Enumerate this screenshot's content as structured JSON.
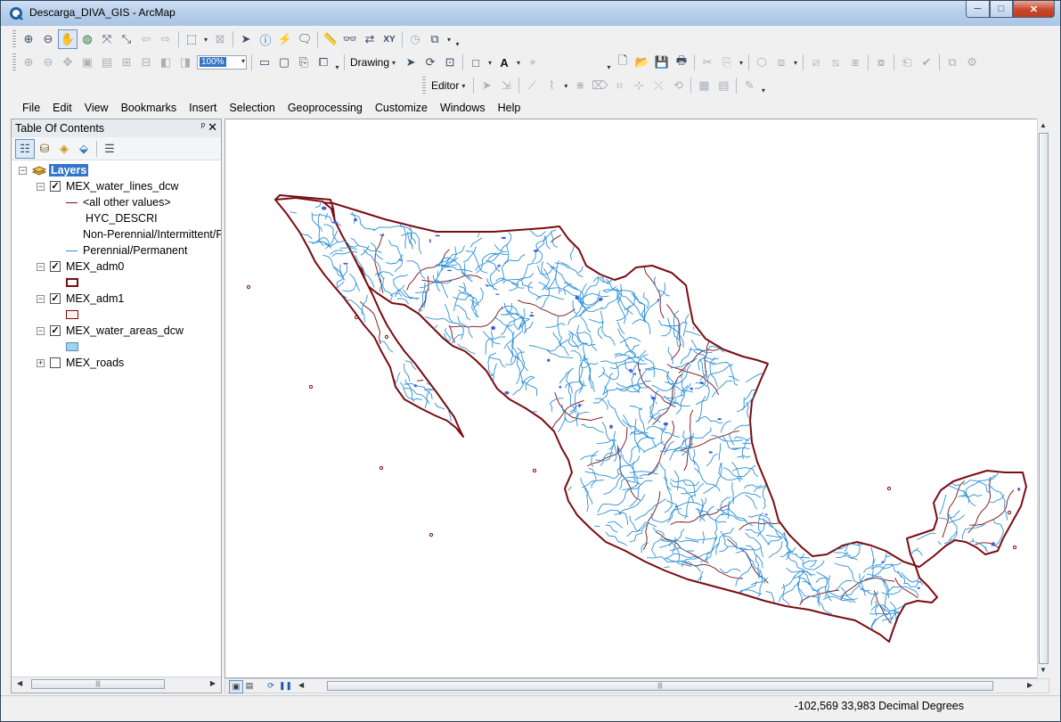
{
  "window": {
    "title": "Descarga_DIVA_GIS - ArcMap",
    "controls": {
      "minimize": "─",
      "maximize": "□",
      "close": "✕"
    }
  },
  "toolbars": {
    "drawing_label": "Drawing",
    "editor_label": "Editor",
    "scale_value": "100%",
    "text_tool": "A"
  },
  "menu": [
    "File",
    "Edit",
    "View",
    "Bookmarks",
    "Insert",
    "Selection",
    "Geoprocessing",
    "Customize",
    "Windows",
    "Help"
  ],
  "toc": {
    "title": "Table Of Contents",
    "pin": "ᵖ",
    "close": "✕",
    "root": "Layers",
    "layers": [
      {
        "name": "MEX_water_lines_dcw",
        "checked": true,
        "expanded": true
      },
      {
        "name": "MEX_adm0",
        "checked": true,
        "expanded": true
      },
      {
        "name": "MEX_adm1",
        "checked": true,
        "expanded": true
      },
      {
        "name": "MEX_water_areas_dcw",
        "checked": true,
        "expanded": true
      },
      {
        "name": "MEX_roads",
        "checked": false,
        "expanded": false
      }
    ],
    "legend": {
      "other_values": "<all other values>",
      "field": "HYC_DESCRI",
      "nonperennial": "Non-Perennial/Intermittent/F",
      "perennial": "Perennial/Permanent"
    }
  },
  "colors": {
    "border": "#7a0c12",
    "admin_fill": "#fdf3ec",
    "river": "#2b8fd6",
    "water_area": "#4a5bd8",
    "water_area_legend": "#9dd4f2",
    "selection": "#3376c9"
  },
  "status": {
    "coords": "-102,569  33,983 Decimal Degrees"
  }
}
